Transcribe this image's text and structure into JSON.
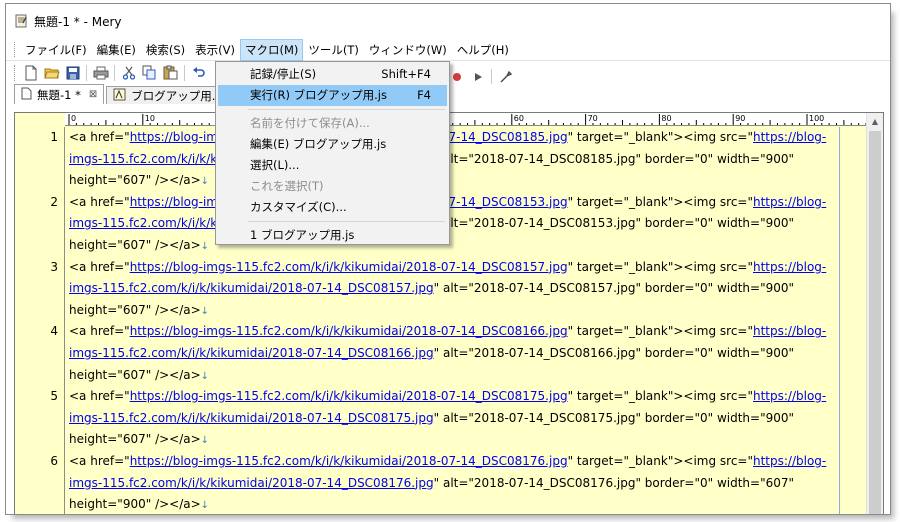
{
  "window": {
    "title": "無題-1 * - Mery"
  },
  "menubar": {
    "items": [
      "ファイル(F)",
      "編集(E)",
      "検索(S)",
      "表示(V)",
      "マクロ(M)",
      "ツール(T)",
      "ウィンドウ(W)",
      "ヘルプ(H)"
    ]
  },
  "tabs": [
    {
      "label": "無題-1 *",
      "close": "⊠"
    },
    {
      "label": "ブログアップ用.js"
    }
  ],
  "macro_menu": {
    "record": "記録/停止(S)",
    "record_shortcut": "Shift+F4",
    "run": "実行(R) ブログアップ用.js",
    "run_shortcut": "F4",
    "save_as": "名前を付けて保存(A)...",
    "edit": "編集(E) ブログアップ用.js",
    "select": "選択(L)...",
    "select_this": "これを選択(T)",
    "customize": "カスタマイズ(C)...",
    "recent": "1 ブログアップ用.js"
  },
  "ruler": {
    "labels": [
      "0",
      "10",
      "20",
      "30",
      "40",
      "50",
      "60",
      "70",
      "80",
      "90",
      "100"
    ]
  },
  "editor": {
    "lines": [
      {
        "num": "1",
        "rows": [
          [
            {
              "t": "<a href=\""
            },
            {
              "t": "https://blog-imgs-115.fc2.com/k/i/k/kikumidai/2018-07-14_DSC08185.jpg",
              "link": true
            },
            {
              "t": "\" target=\"_blank\"><img src=\""
            },
            {
              "t": "https://blog-",
              "link": true
            }
          ],
          [
            {
              "t": "imgs-115.fc2.com/k/i/k/kikumidai/2018-07-14_DSC08185.jpg",
              "link": true
            },
            {
              "t": "\" alt=\"2018-07-14_DSC08185.jpg\" border=\"0\" width=\"900\""
            }
          ],
          [
            {
              "t": "height=\"607\" /></a>"
            },
            {
              "t": "↓",
              "eol": true
            }
          ]
        ]
      },
      {
        "num": "2",
        "rows": [
          [
            {
              "t": "<a href=\""
            },
            {
              "t": "https://blog-imgs-115.fc2.com/k/i/k/kikumidai/2018-07-14_DSC08153.jpg",
              "link": true
            },
            {
              "t": "\" target=\"_blank\"><img src=\""
            },
            {
              "t": "https://blog-",
              "link": true
            }
          ],
          [
            {
              "t": "imgs-115.fc2.com/k/i/k/kikumidai/2018-07-14_DSC08153.jpg",
              "link": true
            },
            {
              "t": "\" alt=\"2018-07-14_DSC08153.jpg\" border=\"0\" width=\"900\""
            }
          ],
          [
            {
              "t": "height=\"607\" /></a>"
            },
            {
              "t": "↓",
              "eol": true
            }
          ]
        ]
      },
      {
        "num": "3",
        "rows": [
          [
            {
              "t": "<a href=\""
            },
            {
              "t": "https://blog-imgs-115.fc2.com/k/i/k/kikumidai/2018-07-14_DSC08157.jpg",
              "link": true
            },
            {
              "t": "\" target=\"_blank\"><img src=\""
            },
            {
              "t": "https://blog-",
              "link": true
            }
          ],
          [
            {
              "t": "imgs-115.fc2.com/k/i/k/kikumidai/2018-07-14_DSC08157.jpg",
              "link": true
            },
            {
              "t": "\" alt=\"2018-07-14_DSC08157.jpg\" border=\"0\" width=\"900\""
            }
          ],
          [
            {
              "t": "height=\"607\" /></a>"
            },
            {
              "t": "↓",
              "eol": true
            }
          ]
        ]
      },
      {
        "num": "4",
        "rows": [
          [
            {
              "t": "<a href=\""
            },
            {
              "t": "https://blog-imgs-115.fc2.com/k/i/k/kikumidai/2018-07-14_DSC08166.jpg",
              "link": true
            },
            {
              "t": "\" target=\"_blank\"><img src=\""
            },
            {
              "t": "https://blog-",
              "link": true
            }
          ],
          [
            {
              "t": "imgs-115.fc2.com/k/i/k/kikumidai/2018-07-14_DSC08166.jpg",
              "link": true
            },
            {
              "t": "\" alt=\"2018-07-14_DSC08166.jpg\" border=\"0\" width=\"900\""
            }
          ],
          [
            {
              "t": "height=\"607\" /></a>"
            },
            {
              "t": "↓",
              "eol": true
            }
          ]
        ]
      },
      {
        "num": "5",
        "rows": [
          [
            {
              "t": "<a href=\""
            },
            {
              "t": "https://blog-imgs-115.fc2.com/k/i/k/kikumidai/2018-07-14_DSC08175.jpg",
              "link": true
            },
            {
              "t": "\" target=\"_blank\"><img src=\""
            },
            {
              "t": "https://blog-",
              "link": true
            }
          ],
          [
            {
              "t": "imgs-115.fc2.com/k/i/k/kikumidai/2018-07-14_DSC08175.jpg",
              "link": true
            },
            {
              "t": "\" alt=\"2018-07-14_DSC08175.jpg\" border=\"0\" width=\"900\""
            }
          ],
          [
            {
              "t": "height=\"607\" /></a>"
            },
            {
              "t": "↓",
              "eol": true
            }
          ]
        ]
      },
      {
        "num": "6",
        "rows": [
          [
            {
              "t": "<a href=\""
            },
            {
              "t": "https://blog-imgs-115.fc2.com/k/i/k/kikumidai/2018-07-14_DSC08176.jpg",
              "link": true
            },
            {
              "t": "\" target=\"_blank\"><img src=\""
            },
            {
              "t": "https://blog-",
              "link": true
            }
          ],
          [
            {
              "t": "imgs-115.fc2.com/k/i/k/kikumidai/2018-07-14_DSC08176.jpg",
              "link": true
            },
            {
              "t": "\" alt=\"2018-07-14_DSC08176.jpg\" border=\"0\" width=\"607\""
            }
          ],
          [
            {
              "t": "height=\"900\" /></a>"
            },
            {
              "t": "↓",
              "eol": true
            }
          ]
        ]
      }
    ]
  }
}
